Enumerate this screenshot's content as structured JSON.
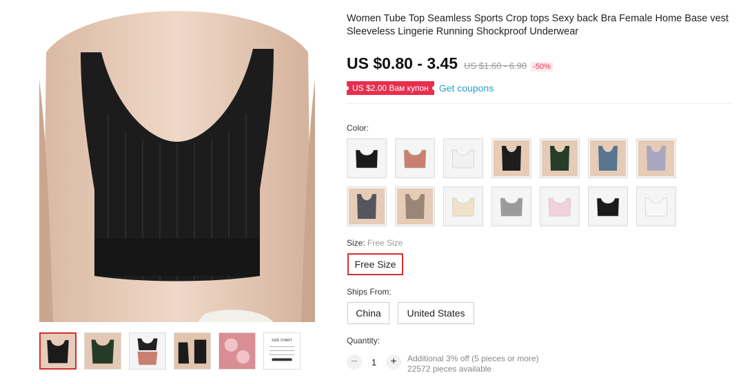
{
  "product": {
    "title": "Women Tube Top Seamless Sports Crop tops Sexy back Bra Female Home Base vest Sleeveless Lingerie Running Shockproof Underwear",
    "price": "US $0.80 - 3.45",
    "old_price": "US $1.60 - 6.90",
    "discount": "-50%",
    "coupon_badge": "US $2.00 Вам купон",
    "get_coupons": "Get coupons"
  },
  "gallery": {
    "main_image_icon": "black-crop-top-photo",
    "thumbnails": [
      {
        "icon": "black-top-thumb",
        "active": true
      },
      {
        "icon": "green-top-thumb",
        "active": false
      },
      {
        "icon": "pink-top-thumb",
        "active": false
      },
      {
        "icon": "black-back-thumb",
        "active": false
      },
      {
        "icon": "pink-detail-thumb",
        "active": false
      },
      {
        "icon": "size-chart-thumb",
        "active": false,
        "text": "SIZE CHART"
      }
    ]
  },
  "color": {
    "label": "Color:",
    "swatches": [
      {
        "name": "black-top",
        "color": "#1a1a1a",
        "skin": false
      },
      {
        "name": "pink-top",
        "color": "#c98070",
        "skin": false
      },
      {
        "name": "white-top",
        "color": "#f1f1f1",
        "skin": false
      },
      {
        "name": "black-model",
        "color": "#1d1d1d",
        "skin": true
      },
      {
        "name": "green-model",
        "color": "#263d29",
        "skin": true
      },
      {
        "name": "blue-model",
        "color": "#58758d",
        "skin": true
      },
      {
        "name": "lavender-model",
        "color": "#a9a7c0",
        "skin": true
      },
      {
        "name": "gray-model",
        "color": "#55555f",
        "skin": true
      },
      {
        "name": "taupe-model",
        "color": "#9a8578",
        "skin": true
      },
      {
        "name": "beige-cami",
        "color": "#f0e2c8",
        "skin": false
      },
      {
        "name": "gray-cami",
        "color": "#9b9b9b",
        "skin": false
      },
      {
        "name": "pink-cami",
        "color": "#f2d2da",
        "skin": false
      },
      {
        "name": "black-cami",
        "color": "#1a1a1a",
        "skin": false
      },
      {
        "name": "white-cami",
        "color": "#f7f7f7",
        "skin": false
      }
    ]
  },
  "size": {
    "label": "Size:",
    "selected": "Free Size",
    "options": [
      "Free Size"
    ]
  },
  "ships_from": {
    "label": "Ships From:",
    "options": [
      "China",
      "United States"
    ]
  },
  "quantity": {
    "label": "Quantity:",
    "minus": "−",
    "value": "1",
    "plus": "+",
    "offer": "Additional 3% off (5 pieces or more)",
    "available": "22572 pieces available"
  },
  "colors": {
    "accent": "#e62e4d",
    "selected_border": "#d32f2f",
    "link": "#2b9bd1"
  }
}
